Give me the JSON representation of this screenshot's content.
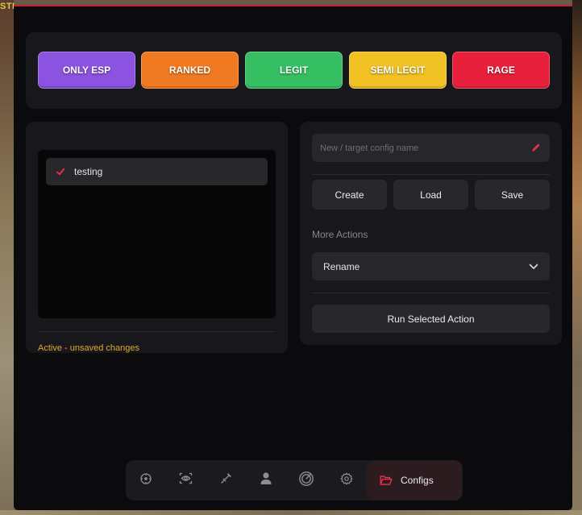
{
  "corner_tag": "STI",
  "presets": [
    {
      "label": "ONLY ESP",
      "color": "#8c52e0"
    },
    {
      "label": "RANKED",
      "color": "#f07a22"
    },
    {
      "label": "LEGIT",
      "color": "#35bf62"
    },
    {
      "label": "SEMI LEGIT",
      "color": "#f2c224"
    },
    {
      "label": "RAGE",
      "color": "#e8203c"
    }
  ],
  "config_list": {
    "items": [
      "testing"
    ],
    "status": "Active - unsaved changes"
  },
  "actions": {
    "name_placeholder": "New / target config name",
    "create_label": "Create",
    "load_label": "Load",
    "save_label": "Save",
    "more_label": "More Actions",
    "selected_action": "Rename",
    "run_label": "Run Selected Action"
  },
  "nav": {
    "icons": [
      "crosshair-icon",
      "eye-scan-icon",
      "syringe-icon",
      "person-icon",
      "gauge-icon",
      "gear-icon"
    ],
    "active_label": "Configs",
    "active_icon": "folder-open-icon"
  },
  "colors": {
    "accent": "#e5304f",
    "status": "#e0a82e"
  }
}
